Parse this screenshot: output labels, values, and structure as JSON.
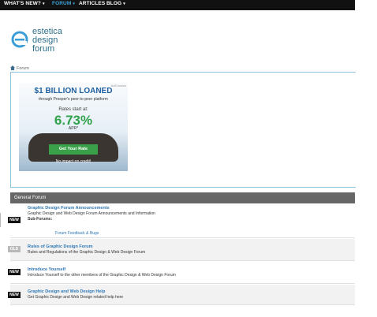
{
  "nav": {
    "items": [
      {
        "label": "WHAT'S NEW?",
        "caret": "▾"
      },
      {
        "label": "FORUM",
        "caret": "▾"
      },
      {
        "label": "ARTICLES"
      },
      {
        "label": "BLOG",
        "caret": "▾"
      }
    ],
    "active_color": "#3ea3d8"
  },
  "logo": {
    "line1": "estetica",
    "line2": "design",
    "line3": "forum",
    "color": "#2c6e8a"
  },
  "breadcrumb": {
    "icon": "home-icon",
    "label": "Forum"
  },
  "ad": {
    "adchoices": "AdChoices",
    "headline": "$1 BILLION LOANED",
    "subline": "through Prosper's peer-to-peer platform",
    "rates_label": "Rates start at:",
    "rate": "6.73%",
    "apr": "APR*",
    "button": "Get Your Rate",
    "footer": "No impact on credit!"
  },
  "section": {
    "title": "General Forum"
  },
  "forums": [
    {
      "badge": "NEW",
      "title": "Graphic Design Forum Announcements",
      "description": "Graphic Design and Web Design Forum Announcements and Information",
      "subforums_label": "Sub-Forums:",
      "subforums": [
        "Forum Feedback & Bugs"
      ]
    },
    {
      "badge": "OLD",
      "title": "Rules of Graphic Design Forum",
      "description": "Rules and Regulations of the Graphic Design & Web Design Forum"
    },
    {
      "badge": "NEW",
      "title": "Introduce Yourself",
      "description": "Introduce Yourself to the other members of the Graphic Design & Web Design Forum"
    },
    {
      "badge": "NEW",
      "title": "Graphic Design and Web Design Help",
      "description": "Get Graphic Design and Web Design related help here"
    }
  ]
}
